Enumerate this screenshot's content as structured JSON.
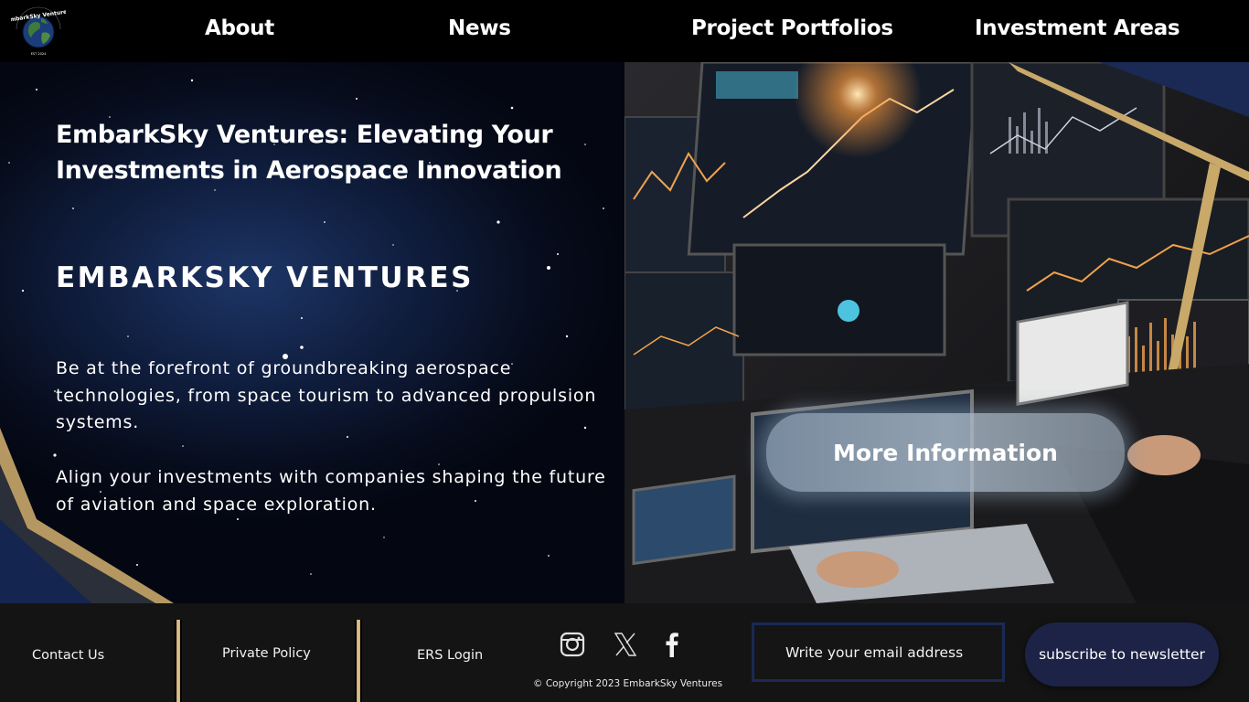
{
  "brand": {
    "logo_text": "EmbarkSky Ventures",
    "logo_sub": "EST 2024"
  },
  "nav": {
    "items": [
      {
        "label": "About"
      },
      {
        "label": "News"
      },
      {
        "label": "Project Portfolios"
      },
      {
        "label": "Investment Areas"
      }
    ]
  },
  "hero": {
    "title": "EmbarkSky Ventures: Elevating Your Investments in Aerospace Innovation",
    "brand_heading": "EMBARKSKY VENTURES",
    "paragraph_1": "Be at the forefront of groundbreaking aerospace technologies, from space tourism to advanced propulsion systems.",
    "paragraph_2": "Align your investments with companies shaping the future of aviation and space exploration.",
    "cta_label": "More Information"
  },
  "footer": {
    "links": [
      {
        "label": "Contact Us"
      },
      {
        "label": "Private Policy"
      },
      {
        "label": "ERS Login"
      }
    ],
    "social": [
      {
        "icon": "instagram-icon"
      },
      {
        "icon": "x-icon"
      },
      {
        "icon": "facebook-icon"
      }
    ],
    "copyright": "© Copyright 2023 EmbarkSky Ventures",
    "email_placeholder": "Write your email address",
    "subscribe_label": "subscribe to newsletter"
  },
  "colors": {
    "background": "#000000",
    "footer_bg": "#141414",
    "accent_gold": "#c7a36a",
    "accent_navy": "#1c2347",
    "space_blue": "#0f1d3d"
  }
}
